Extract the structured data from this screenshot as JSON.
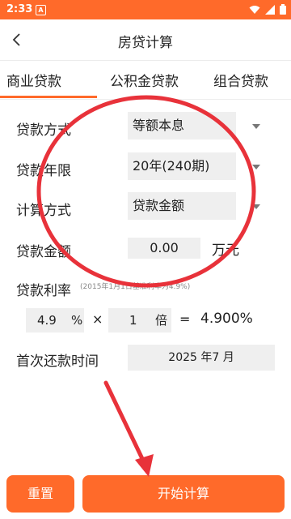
{
  "status": {
    "time": "2:33",
    "notification_letter": "A"
  },
  "header": {
    "title": "房贷计算"
  },
  "tabs": [
    {
      "label": "商业贷款",
      "active": true
    },
    {
      "label": "公积金贷款",
      "active": false
    },
    {
      "label": "组合贷款",
      "active": false
    }
  ],
  "form": {
    "loan_type": {
      "label": "贷款方式",
      "value": "等额本息"
    },
    "loan_term": {
      "label": "贷款年限",
      "value": "20年(240期)"
    },
    "calc_method": {
      "label": "计算方式",
      "value": "贷款金额"
    },
    "loan_amount": {
      "label": "贷款金额",
      "value": "0.00",
      "unit": "万元"
    },
    "rate": {
      "label": "贷款利率",
      "note": "(2015年1月1日基准利率为4.9%)",
      "base_value": "4.9",
      "base_unit": "%",
      "multiply_symbol": "×",
      "multiplier": "1",
      "multiplier_unit": "倍",
      "equals_symbol": "=",
      "result": "4.900%"
    },
    "first_payment": {
      "label": "首次还款时间",
      "value": "2025 年7 月"
    }
  },
  "buttons": {
    "reset": "重置",
    "calculate": "开始计算"
  },
  "colors": {
    "accent": "#ff6a2a",
    "annotation": "#e8323a"
  }
}
